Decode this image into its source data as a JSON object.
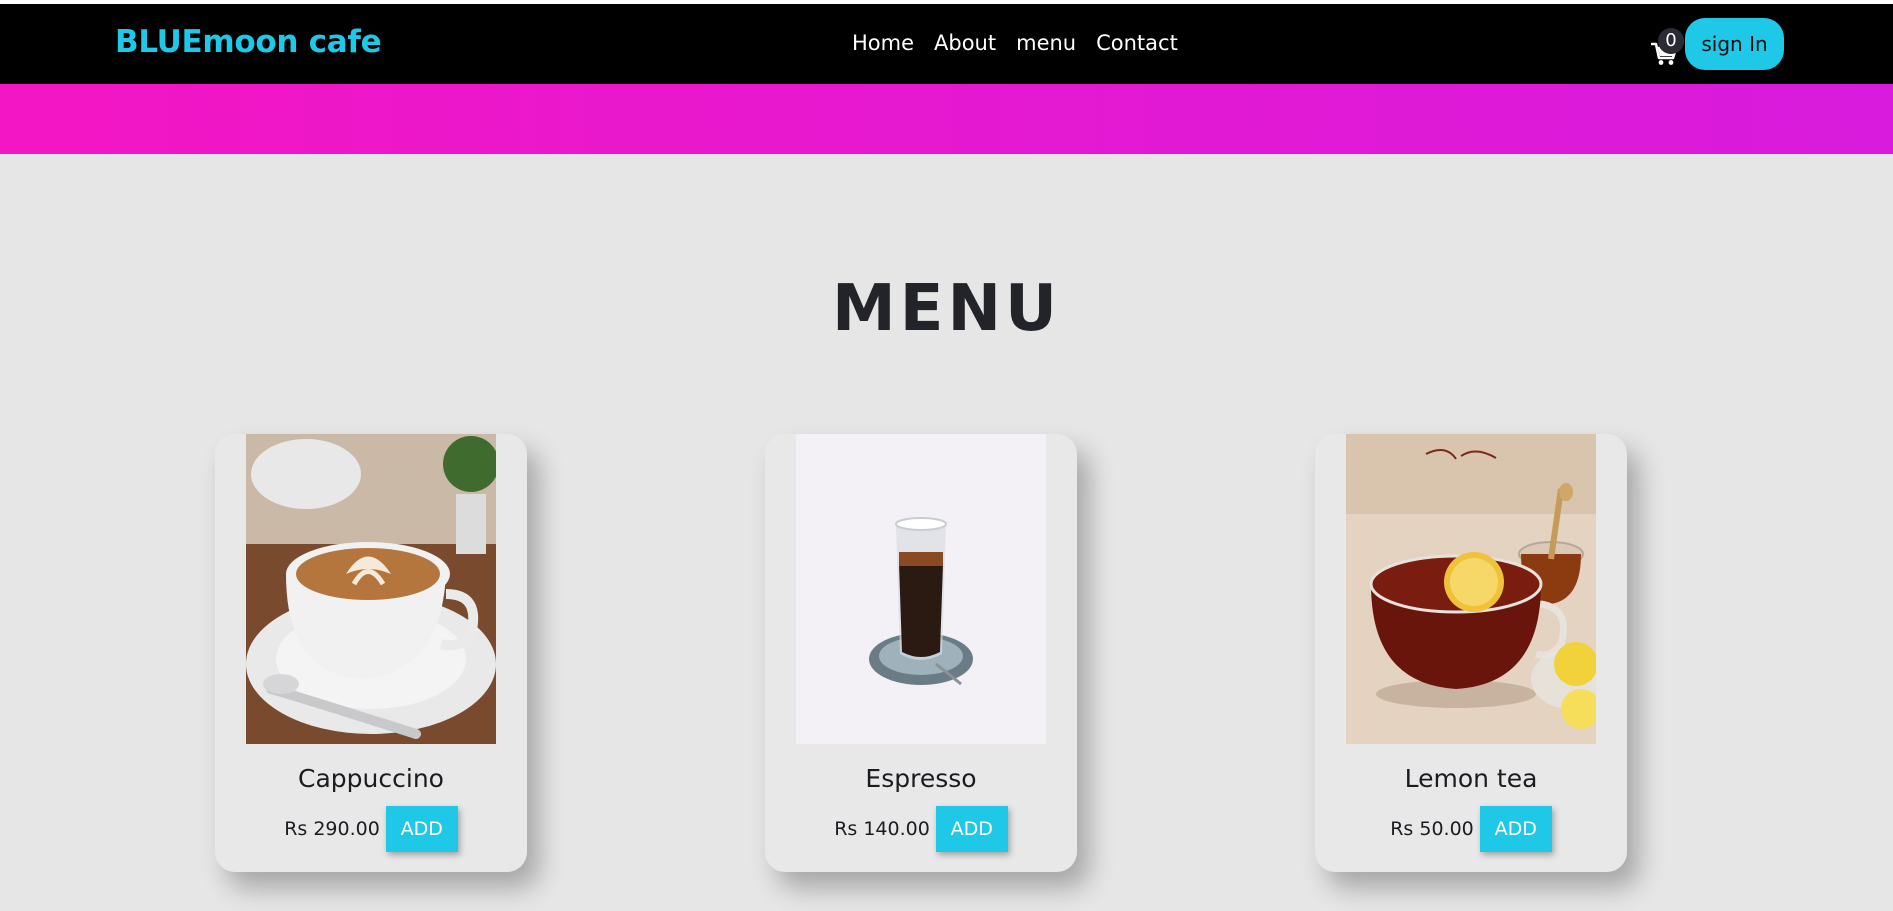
{
  "brand": "BLUEmoon cafe",
  "nav": {
    "links": [
      "Home",
      "About",
      "menu",
      "Contact"
    ],
    "cart_count": "0",
    "signin_label": "sign In"
  },
  "menu": {
    "title": "MENU",
    "items": [
      {
        "name": "Cappuccino",
        "price": "Rs 290.00",
        "add_label": "ADD",
        "image": "cappuccino-photo"
      },
      {
        "name": "Espresso",
        "price": "Rs 140.00",
        "add_label": "ADD",
        "image": "espresso-photo"
      },
      {
        "name": "Lemon tea",
        "price": "Rs 50.00",
        "add_label": "ADD",
        "image": "lemon-tea-photo"
      }
    ]
  },
  "colors": {
    "brand": "#1ec8e6",
    "navbar": "#000000",
    "banner_start": "#f316c4",
    "banner_end": "#d81bdd",
    "page_bg": "#e6e6e6",
    "button": "#1ec8e6"
  },
  "icons": {
    "cart": "shopping-cart-icon"
  }
}
